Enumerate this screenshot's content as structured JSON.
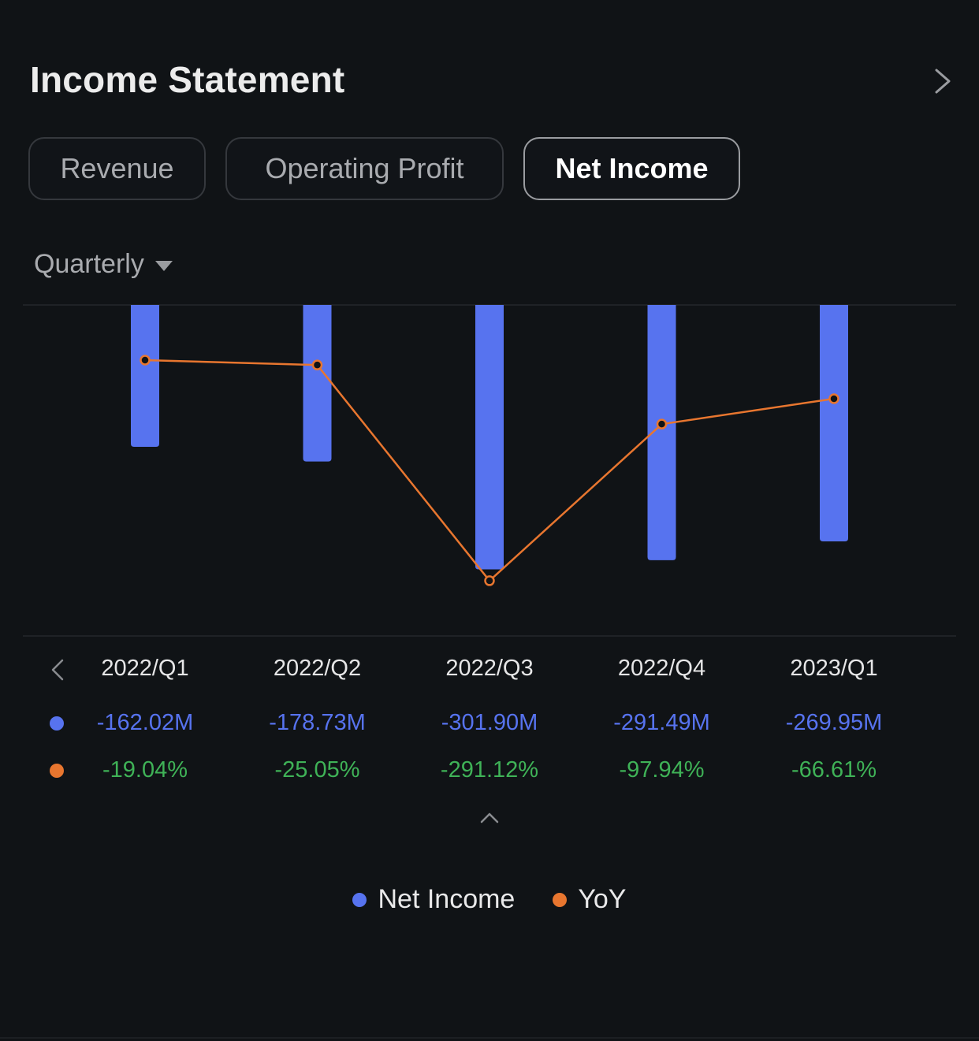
{
  "header": {
    "title": "Income Statement",
    "more_icon": "chevron-right-icon"
  },
  "tabs": [
    {
      "label": "Revenue",
      "active": false
    },
    {
      "label": "Operating Profit",
      "active": false
    },
    {
      "label": "Net Income",
      "active": true
    }
  ],
  "period_selector": {
    "label": "Quarterly",
    "icon": "caret-down-icon"
  },
  "colors": {
    "background": "#101316",
    "bar": "#5773ef",
    "line": "#e8762f",
    "negative_pct": "#3fb257",
    "grid": "#24272b"
  },
  "chart_data": {
    "type": "bar",
    "title": "",
    "xlabel": "",
    "ylabel": "",
    "categories": [
      "2022/Q1",
      "2022/Q2",
      "2022/Q3",
      "2022/Q4",
      "2023/Q1"
    ],
    "series": [
      {
        "name": "Net Income",
        "type": "bar",
        "unit": "M",
        "axis": "left",
        "values": [
          -162.02,
          -178.73,
          -301.9,
          -291.49,
          -269.95
        ],
        "labels": [
          "-162.02M",
          "-178.73M",
          "-301.90M",
          "-291.49M",
          "-269.95M"
        ]
      },
      {
        "name": "YoY",
        "type": "line",
        "unit": "%",
        "axis": "right",
        "values": [
          -19.04,
          -25.05,
          -291.12,
          -97.94,
          -66.61
        ],
        "labels": [
          "-19.04%",
          "-25.05%",
          "-291.12%",
          "-97.94%",
          "-66.61%"
        ]
      }
    ],
    "ylim": [
      -369,
      0
    ],
    "ylim_right": [
      -349.5,
      49
    ],
    "grid": false,
    "legend": "bottom-center"
  },
  "table_nav": {
    "prev_icon": "chevron-left-icon",
    "collapse_icon": "chevron-up-icon"
  },
  "legend": [
    {
      "label": "Net Income",
      "color": "#5773ef"
    },
    {
      "label": "YoY",
      "color": "#e8762f"
    }
  ]
}
